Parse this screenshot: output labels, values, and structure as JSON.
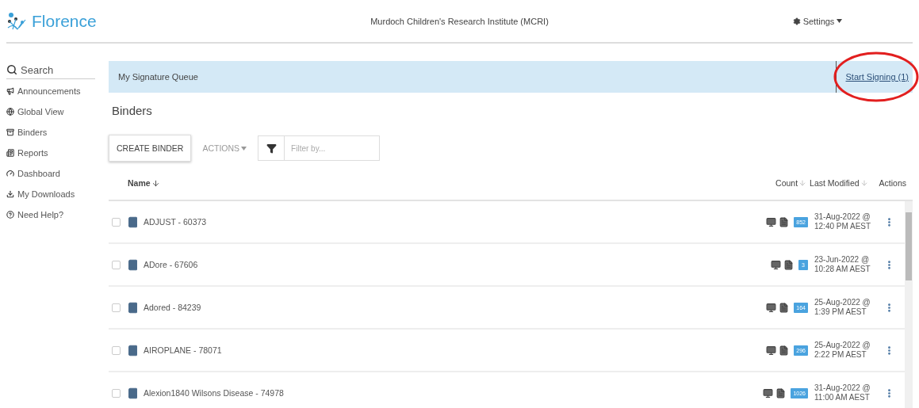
{
  "header": {
    "logo": "Florence",
    "organization": "Murdoch Children's Research Institute (MCRI)",
    "settings": "Settings"
  },
  "sidebar": {
    "items": [
      {
        "label": "Search",
        "kind": "search"
      },
      {
        "label": "Announcements",
        "kind": "link"
      },
      {
        "label": "Global View",
        "kind": "link"
      },
      {
        "label": "Binders",
        "kind": "link"
      },
      {
        "label": "Reports",
        "kind": "link"
      },
      {
        "label": "Dashboard",
        "kind": "link"
      },
      {
        "label": "My Downloads",
        "kind": "link"
      },
      {
        "label": "Need Help?",
        "kind": "link"
      }
    ]
  },
  "queue": {
    "title": "My Signature Queue",
    "link": "Start Signing (1)"
  },
  "page_title": "Binders",
  "toolbar": {
    "create": "CREATE BINDER",
    "actions": "ACTIONS",
    "filter": {
      "placeholder": "Filter by..."
    }
  },
  "table": {
    "columns": [
      "Name",
      "Count",
      "Last Modified",
      "Actions"
    ],
    "rows": [
      {
        "name": "ADJUST - 60373",
        "checked": false,
        "count": "852",
        "date": "31-Aug-2022 @",
        "time": "12:40 PM AEST"
      },
      {
        "name": "ADore - 67606",
        "checked": false,
        "count": "3",
        "date": "23-Jun-2022 @",
        "time": "10:28 AM AEST"
      },
      {
        "name": "Adored - 84239",
        "checked": false,
        "count": "164",
        "date": "25-Aug-2022 @",
        "time": "1:39 PM AEST"
      },
      {
        "name": "AIROPLANE - 78071",
        "checked": false,
        "count": "296",
        "date": "25-Aug-2022 @",
        "time": "2:22 PM AEST"
      },
      {
        "name": "Alexion1840 Wilsons Disease - 74978",
        "checked": false,
        "count": "1026",
        "date": "31-Aug-2022 @",
        "time": "11:00 AM AEST"
      }
    ]
  }
}
